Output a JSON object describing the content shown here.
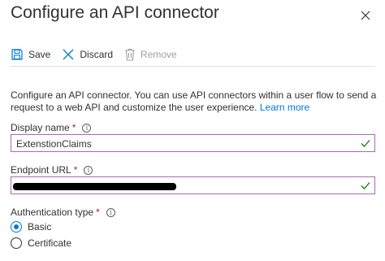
{
  "panel": {
    "title": "Configure an API connector",
    "close_icon": "close-icon"
  },
  "toolbar": {
    "save_label": "Save",
    "discard_label": "Discard",
    "remove_label": "Remove",
    "save_icon": "save-icon",
    "discard_icon": "discard-icon",
    "remove_icon": "trash-icon",
    "remove_disabled": true
  },
  "description": {
    "text": "Configure an API connector. You can use API connectors within a user flow to send a request to a web API and customize the user experience.",
    "link_text": "Learn more"
  },
  "display_name": {
    "label": "Display name",
    "required_marker": "*",
    "value": "ExtenstionClaims",
    "valid": true
  },
  "endpoint_url": {
    "label": "Endpoint URL",
    "required_marker": "*",
    "value_redacted": true,
    "valid": true
  },
  "auth_type": {
    "label": "Authentication type",
    "required_marker": "*",
    "options": [
      "Basic",
      "Certificate"
    ],
    "selected": "Basic"
  },
  "colors": {
    "accent": "#0078d4",
    "required": "#a4262c",
    "valid_check": "#107c10",
    "field_border": "#a867b8"
  }
}
